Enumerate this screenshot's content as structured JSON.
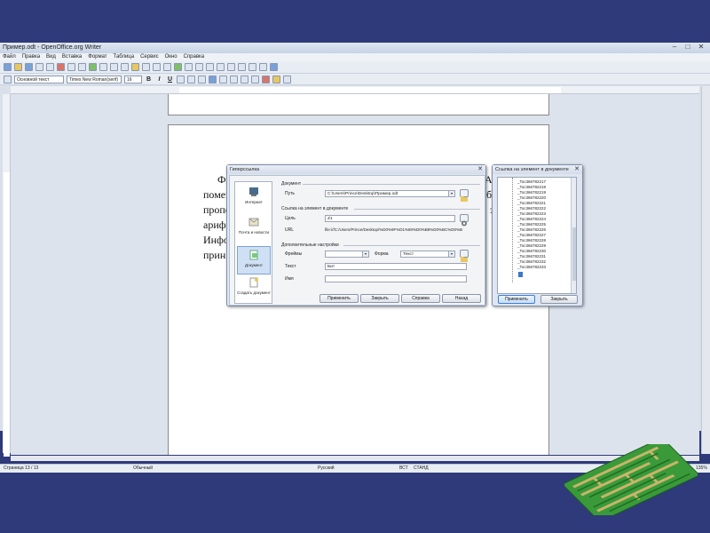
{
  "window": {
    "title": "Пример.odt - OpenOffice.org Writer",
    "controls": [
      "–",
      "□",
      "✕"
    ]
  },
  "menu": [
    "Файл",
    "Правка",
    "Вид",
    "Вставка",
    "Формат",
    "Таблица",
    "Сервис",
    "Окно",
    "Справка"
  ],
  "formatting": {
    "style": "Основной текст",
    "font": "Times New Roman(serif)",
    "size": "16"
  },
  "document": {
    "fragments": [
      "Фа",
      "помеш",
      "пропе",
      "арифм",
      "Инфор",
      "прин"
    ],
    "fragments_right": [
      "А",
      "б",
      "за"
    ]
  },
  "hyperlink_dialog": {
    "title": "Гиперссылка",
    "nav": [
      "Интернет",
      "Почта и новости",
      "Документ",
      "Создать документ"
    ],
    "sections": {
      "document": "Документ",
      "target": "Ссылка на элемент в документе",
      "extra": "Дополнительные настройки"
    },
    "labels": {
      "path": "Путь",
      "target": "Цель",
      "url": "URL",
      "frame": "Фреймы",
      "form": "Форма",
      "text": "Текст",
      "name": "Имя"
    },
    "values": {
      "path": "C:\\Users\\Prince\\Desktop\\Пример.odt",
      "target": "Z1",
      "url": "file:///C:/Users/Prince/Desktop/%D0%9F%D1%80%D0%B8%D0%BC%D0%B",
      "frame": "",
      "form": "Текст",
      "text": "Бит",
      "name": ""
    },
    "buttons": [
      "Применить",
      "Закрыть",
      "Справка",
      "Назад"
    ]
  },
  "target_dialog": {
    "title": "Ссылка на элемент в документе",
    "items": [
      "_Toc366782217",
      "_Toc366782218",
      "_Toc366782219",
      "_Toc366782220",
      "_Toc366782221",
      "_Toc366782222",
      "_Toc366782223",
      "_Toc366782224",
      "_Toc366782225",
      "_Toc366782226",
      "_Toc366782227",
      "_Toc366782228",
      "_Toc366782229",
      "_Toc366782230",
      "_Toc366782231",
      "_Toc366782232",
      "_Toc366782233"
    ],
    "buttons": [
      "Применить",
      "Закрыть"
    ]
  },
  "status": {
    "page": "Страница 13 / 13",
    "style": "Обычный",
    "language": "Русский",
    "insert": "ВСТ",
    "std": "СТАНД",
    "zoom": "135%"
  },
  "colors": {
    "slide_bg": "#2f3a7a",
    "maze_green": "#2e8b2e"
  }
}
